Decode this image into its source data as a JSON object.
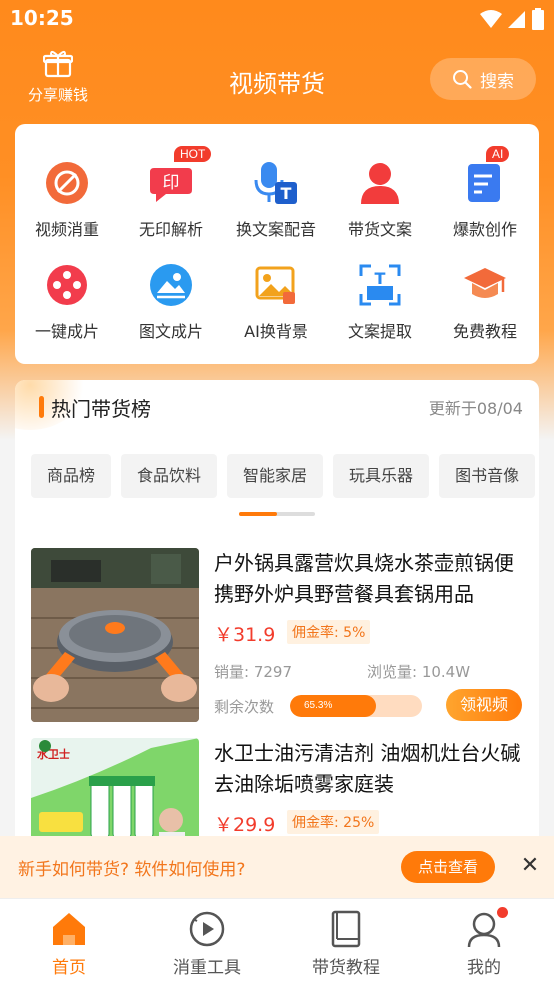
{
  "status": {
    "time": "10:25"
  },
  "header": {
    "share_label": "分享赚钱",
    "title": "视频带货",
    "search_label": "搜索"
  },
  "tools": [
    {
      "label": "视频消重",
      "icon": "no-repeat-icon",
      "color": "#f26a3a"
    },
    {
      "label": "无印解析",
      "icon": "stamp-icon",
      "color": "#f23c4c",
      "badge": "HOT"
    },
    {
      "label": "换文案配音",
      "icon": "mic-text-icon",
      "color": "#3a8af0"
    },
    {
      "label": "带货文案",
      "icon": "user-icon",
      "color": "#f23c3c"
    },
    {
      "label": "爆款创作",
      "icon": "document-edit-icon",
      "color": "#3a7af0",
      "badge": "AI"
    },
    {
      "label": "一键成片",
      "icon": "film-reel-icon",
      "color": "#f23c4c"
    },
    {
      "label": "图文成片",
      "icon": "image-circle-icon",
      "color": "#2a9af0"
    },
    {
      "label": "AI换背景",
      "icon": "image-swap-icon",
      "color": "#f2a21c"
    },
    {
      "label": "文案提取",
      "icon": "text-scan-icon",
      "color": "#2a8af0"
    },
    {
      "label": "免费教程",
      "icon": "graduation-cap-icon",
      "color": "#f26a3a"
    }
  ],
  "hot": {
    "title": "热门带货榜",
    "updated": "更新于08/04",
    "categories": [
      "商品榜",
      "食品饮料",
      "智能家居",
      "玩具乐器",
      "图书音像"
    ],
    "products": [
      {
        "title": "户外锅具露营炊具烧水茶壶煎锅便携野外炉具野营餐具套锅用品",
        "price": "￥31.9",
        "commission": "佣金率: 5%",
        "sales": "销量: 7297",
        "views": "浏览量: 10.4W",
        "remain_label": "剩余次数",
        "progress_text": "65.3%",
        "progress": 0.653,
        "button": "领视频"
      },
      {
        "title": "水卫士油污清洁剂 油烟机灶台火碱去油除垢喷雾家庭装",
        "price": "￥29.9",
        "commission": "佣金率: 25%",
        "brand": "水卫士"
      }
    ]
  },
  "tip": {
    "text": "新手如何带货? 软件如何使用?",
    "button": "点击查看",
    "close": "✕"
  },
  "tabs": [
    {
      "label": "首页",
      "icon": "home-icon",
      "active": true
    },
    {
      "label": "消重工具",
      "icon": "play-circle-icon",
      "active": false
    },
    {
      "label": "带货教程",
      "icon": "book-icon",
      "active": false
    },
    {
      "label": "我的",
      "icon": "profile-icon",
      "active": false
    }
  ]
}
